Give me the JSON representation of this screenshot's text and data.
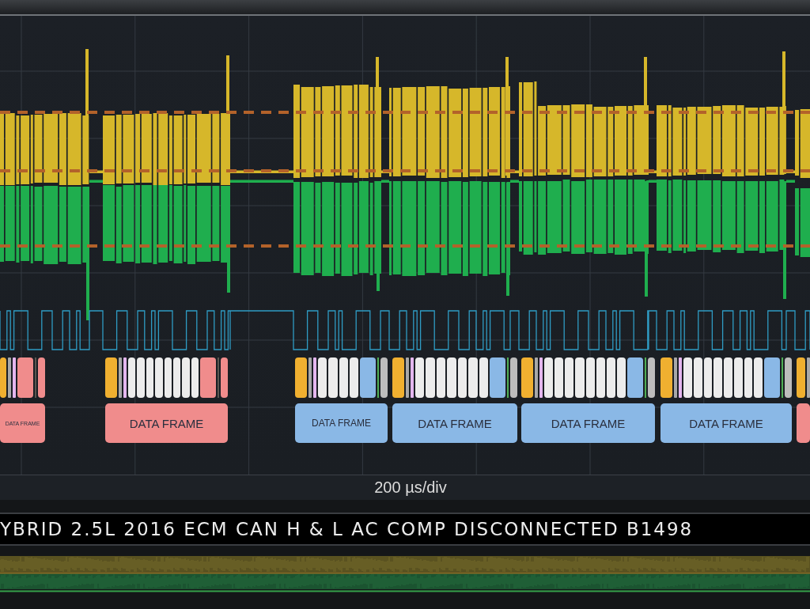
{
  "decode": {
    "frames": [
      {
        "label": "DATA FRAME",
        "color": "#f08c8c",
        "fields": [
          {
            "kind": "id",
            "color": "#f0b030"
          },
          {
            "kind": "ctrl",
            "color": "#a8a8a8"
          },
          {
            "kind": "dlc",
            "color": "#e4b6ef"
          },
          {
            "kind": "crc",
            "color": "#f08c8c"
          },
          {
            "kind": "ack",
            "color": "#5a5650"
          },
          {
            "kind": "eof",
            "color": "#f08c8c"
          }
        ]
      },
      {
        "label": "DATA FRAME",
        "color": "#f08c8c",
        "fields": [
          {
            "kind": "id",
            "color": "#f0b030"
          },
          {
            "kind": "ctrl",
            "color": "#a8a8a8"
          },
          {
            "kind": "dlc",
            "color": "#e4b6ef"
          },
          {
            "kind": "data",
            "color": "#ececec"
          },
          {
            "kind": "data",
            "color": "#ececec"
          },
          {
            "kind": "data",
            "color": "#ececec"
          },
          {
            "kind": "data",
            "color": "#ececec"
          },
          {
            "kind": "data",
            "color": "#ececec"
          },
          {
            "kind": "data",
            "color": "#ececec"
          },
          {
            "kind": "data",
            "color": "#ececec"
          },
          {
            "kind": "data",
            "color": "#ececec"
          },
          {
            "kind": "crc",
            "color": "#f08c8c"
          },
          {
            "kind": "ack",
            "color": "#5a5650"
          },
          {
            "kind": "eof",
            "color": "#f08c8c"
          }
        ]
      },
      {
        "label": "DATA FRAME",
        "color": "#8ab8e6",
        "fields": [
          {
            "kind": "id",
            "color": "#f0b030"
          },
          {
            "kind": "ctrl",
            "color": "#a8a8a8"
          },
          {
            "kind": "dlc",
            "color": "#e4b6ef"
          },
          {
            "kind": "data",
            "color": "#ececec"
          },
          {
            "kind": "data",
            "color": "#ececec"
          },
          {
            "kind": "data",
            "color": "#ececec"
          },
          {
            "kind": "data",
            "color": "#ececec"
          },
          {
            "kind": "crc",
            "color": "#8ab8e6"
          },
          {
            "kind": "ack",
            "color": "#4fae55"
          },
          {
            "kind": "eof",
            "color": "#bdbdbd"
          }
        ]
      },
      {
        "label": "DATA FRAME",
        "color": "#8ab8e6",
        "fields": [
          {
            "kind": "id",
            "color": "#f0b030"
          },
          {
            "kind": "ctrl",
            "color": "#a8a8a8"
          },
          {
            "kind": "dlc",
            "color": "#e4b6ef"
          },
          {
            "kind": "data",
            "color": "#ececec"
          },
          {
            "kind": "data",
            "color": "#ececec"
          },
          {
            "kind": "data",
            "color": "#ececec"
          },
          {
            "kind": "data",
            "color": "#ececec"
          },
          {
            "kind": "data",
            "color": "#ececec"
          },
          {
            "kind": "data",
            "color": "#ececec"
          },
          {
            "kind": "data",
            "color": "#ececec"
          },
          {
            "kind": "crc",
            "color": "#8ab8e6"
          },
          {
            "kind": "ack",
            "color": "#4fae55"
          },
          {
            "kind": "eof",
            "color": "#bdbdbd"
          }
        ]
      },
      {
        "label": "DATA FRAME",
        "color": "#8ab8e6",
        "fields": [
          {
            "kind": "id",
            "color": "#f0b030"
          },
          {
            "kind": "ctrl",
            "color": "#a8a8a8"
          },
          {
            "kind": "dlc",
            "color": "#e4b6ef"
          },
          {
            "kind": "data",
            "color": "#ececec"
          },
          {
            "kind": "data",
            "color": "#ececec"
          },
          {
            "kind": "data",
            "color": "#ececec"
          },
          {
            "kind": "data",
            "color": "#ececec"
          },
          {
            "kind": "data",
            "color": "#ececec"
          },
          {
            "kind": "data",
            "color": "#ececec"
          },
          {
            "kind": "data",
            "color": "#ececec"
          },
          {
            "kind": "data",
            "color": "#ececec"
          },
          {
            "kind": "crc",
            "color": "#8ab8e6"
          },
          {
            "kind": "ack",
            "color": "#4fae55"
          },
          {
            "kind": "eof",
            "color": "#bdbdbd"
          }
        ]
      },
      {
        "label": "DATA FRAME",
        "color": "#8ab8e6",
        "fields": [
          {
            "kind": "id",
            "color": "#f0b030"
          },
          {
            "kind": "ctrl",
            "color": "#a8a8a8"
          },
          {
            "kind": "dlc",
            "color": "#e4b6ef"
          },
          {
            "kind": "data",
            "color": "#ececec"
          },
          {
            "kind": "data",
            "color": "#ececec"
          },
          {
            "kind": "data",
            "color": "#ececec"
          },
          {
            "kind": "data",
            "color": "#ececec"
          },
          {
            "kind": "data",
            "color": "#ececec"
          },
          {
            "kind": "data",
            "color": "#ececec"
          },
          {
            "kind": "data",
            "color": "#ececec"
          },
          {
            "kind": "data",
            "color": "#ececec"
          },
          {
            "kind": "crc",
            "color": "#8ab8e6"
          },
          {
            "kind": "ack",
            "color": "#4fae55"
          },
          {
            "kind": "eof",
            "color": "#bdbdbd"
          }
        ]
      },
      {
        "color": "#f08c8c",
        "fields": [
          {
            "kind": "id",
            "color": "#f0b030"
          },
          {
            "kind": "ctrl",
            "color": "#a8a8a8"
          }
        ]
      }
    ]
  },
  "timebase": "200 µs/div",
  "title": "YBRID 2.5L 2016 ECM CAN H & L AC COMP DISCONNECTED B1498"
}
